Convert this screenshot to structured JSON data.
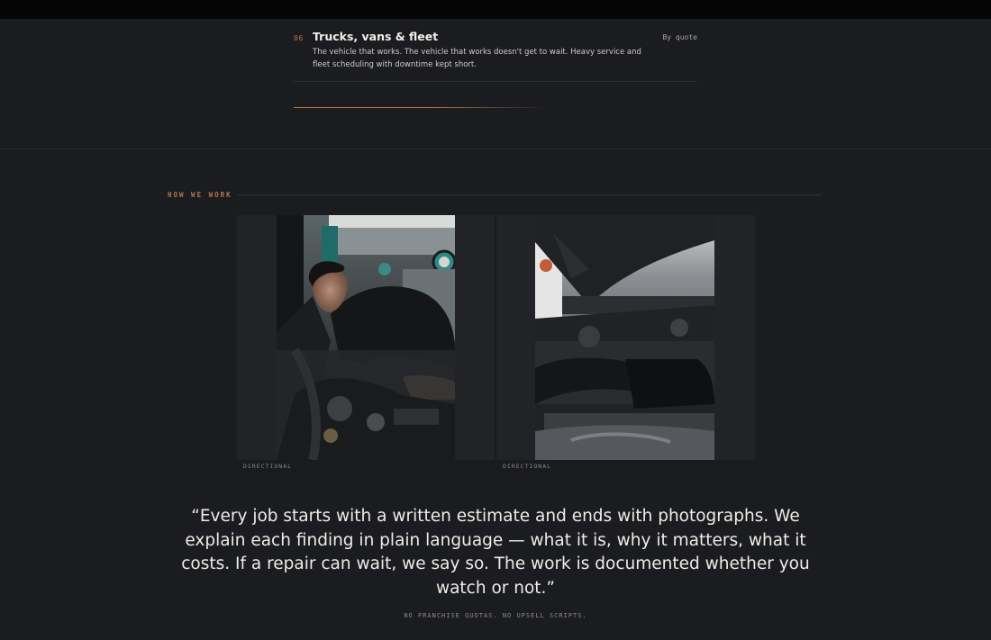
{
  "service": {
    "number": "06",
    "title": "Trucks, vans & fleet",
    "price": "By quote",
    "description": "The vehicle that works. The vehicle that works doesn't get to wait. Heavy service and fleet scheduling with downtime kept short."
  },
  "section": {
    "eyebrow": "HOW WE WORK"
  },
  "photos": [
    {
      "caption": "DIRECTIONAL"
    },
    {
      "caption": "DIRECTIONAL"
    }
  ],
  "quote": {
    "text": "“Every job starts with a written estimate and ends with photographs. We explain each finding in plain language — what it is, why it matters, what it costs. If a repair can wait, we say so. The work is documented whether you watch or not.”",
    "tagline": "NO FRANCHISE QUOTAS. NO UPSELL SCRIPTS."
  },
  "colors": {
    "accent": "#b8744a",
    "background": "#1b1c1f"
  }
}
